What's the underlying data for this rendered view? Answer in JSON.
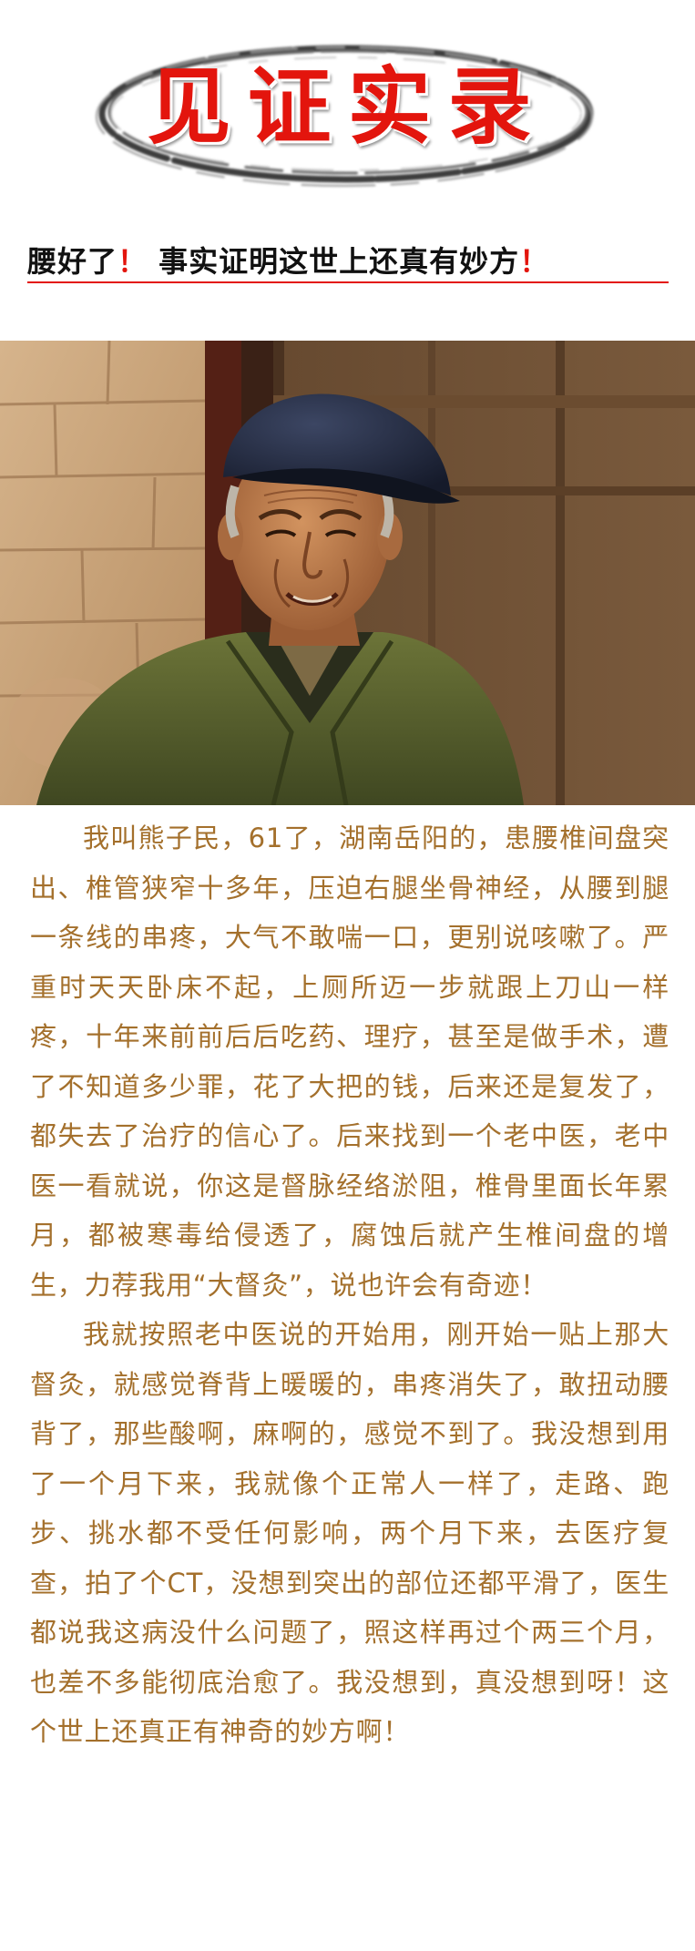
{
  "banner": {
    "title": "见证实录"
  },
  "headline": {
    "part1": "腰好了",
    "excl1": "！",
    "part2": " 事实证明这世上还真有妙方",
    "excl2": "！"
  },
  "photo": {
    "subject": "smiling elderly man in a navy cap and green jacket"
  },
  "story": {
    "paragraphs": [
      "我叫熊子民，61了，湖南岳阳的，患腰椎间盘突出、椎管狭窄十多年，压迫右腿坐骨神经，从腰到腿一条线的串疼，大气不敢喘一口，更别说咳嗽了。严重时天天卧床不起，上厕所迈一步就跟上刀山一样疼，十年来前前后后吃药、理疗，甚至是做手术，遭了不知道多少罪，花了大把的钱，后来还是复发了，都失去了治疗的信心了。后来找到一个老中医，老中医一看就说，你这是督脉经络淤阻，椎骨里面长年累月，都被寒毒给侵透了，腐蚀后就产生椎间盘的增生，力荐我用“大督灸”，说也许会有奇迹！",
      "我就按照老中医说的开始用，刚开始一贴上那大督灸，就感觉脊背上暖暖的，串疼消失了，敢扭动腰背了，那些酸啊，麻啊的，感觉不到了。我没想到用了一个月下来，我就像个正常人一样了，走路、跑步、挑水都不受任何影响，两个月下来，去医疗复查，拍了个CT，没想到突出的部位还都平滑了，医生都说我这病没什么问题了，照这样再过个两三个月，也差不多能彻底治愈了。我没想到，真没想到呀！这个世上还真正有神奇的妙方啊！"
    ]
  },
  "colors": {
    "title_red": "#e3150d",
    "story_text": "#a4702c",
    "headline_text": "#111111"
  }
}
